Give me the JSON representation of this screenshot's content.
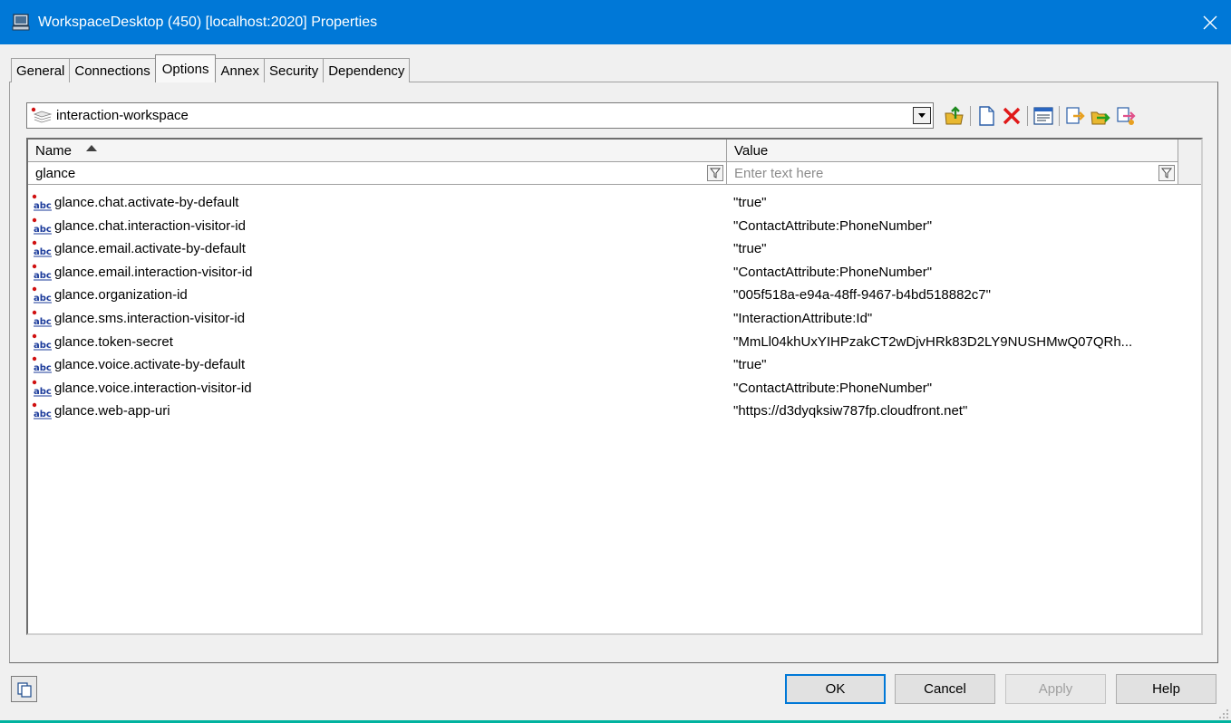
{
  "window": {
    "title": "WorkspaceDesktop (450) [localhost:2020] Properties",
    "title_bar_color": "#0078d7",
    "close_icon": "close-icon"
  },
  "tabs": [
    {
      "label": "General",
      "active": false
    },
    {
      "label": "Connections",
      "active": false
    },
    {
      "label": "Options",
      "active": true
    },
    {
      "label": "Annex",
      "active": false
    },
    {
      "label": "Security",
      "active": false
    },
    {
      "label": "Dependency",
      "active": false
    }
  ],
  "section": {
    "selected": "interaction-workspace",
    "icon": "section-stack-icon"
  },
  "toolbar": {
    "icons": [
      "up-folder-icon",
      "new-document-icon",
      "delete-icon",
      "properties-icon",
      "import-icon",
      "export-icon",
      "copy-icon"
    ]
  },
  "grid": {
    "columns": {
      "name": "Name",
      "value": "Value"
    },
    "sort": "name-ascending",
    "filter": {
      "name_value": "glance",
      "value_placeholder": "Enter text here"
    },
    "rows": [
      {
        "name": "glance.chat.activate-by-default",
        "value": "\"true\""
      },
      {
        "name": "glance.chat.interaction-visitor-id",
        "value": "\"ContactAttribute:PhoneNumber\""
      },
      {
        "name": "glance.email.activate-by-default",
        "value": "\"true\""
      },
      {
        "name": "glance.email.interaction-visitor-id",
        "value": "\"ContactAttribute:PhoneNumber\""
      },
      {
        "name": "glance.organization-id",
        "value": "\"005f518a-e94a-48ff-9467-b4bd518882c7\""
      },
      {
        "name": "glance.sms.interaction-visitor-id",
        "value": "\"InteractionAttribute:Id\""
      },
      {
        "name": "glance.token-secret",
        "value": "\"MmLl04khUxYIHPzakCT2wDjvHRk83D2LY9NUSHMwQ07QRh..."
      },
      {
        "name": "glance.voice.activate-by-default",
        "value": "\"true\""
      },
      {
        "name": "glance.voice.interaction-visitor-id",
        "value": "\"ContactAttribute:PhoneNumber\""
      },
      {
        "name": "glance.web-app-uri",
        "value": "\"https://d3dyqksiw787fp.cloudfront.net\""
      }
    ]
  },
  "buttons": {
    "ok": "OK",
    "cancel": "Cancel",
    "apply": "Apply",
    "help": "Help"
  }
}
